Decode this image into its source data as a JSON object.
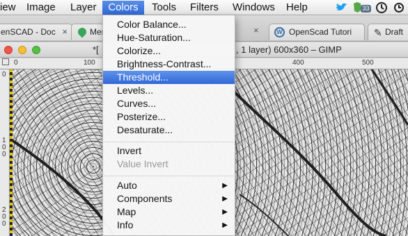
{
  "menubar": {
    "items": [
      "iew",
      "Image",
      "Layer",
      "Colors",
      "Tools",
      "Filters",
      "Windows",
      "Help"
    ],
    "active": "Colors",
    "badge": "33"
  },
  "tabs": [
    {
      "label": "enSCAD - Doc"
    },
    {
      "label": "Mer"
    },
    {
      "label": "OpenScad Tutori"
    },
    {
      "label": "Draft"
    }
  ],
  "window": {
    "title_left": "*[",
    "title_right": ", 1 layer) 600x360 – GIMP"
  },
  "ruler": {
    "h_ticks": [
      "0",
      "100",
      "400",
      "500"
    ],
    "v_ticks": [
      "0",
      "1\n0\n0",
      "2\n0\n0"
    ]
  },
  "colors_menu": {
    "group1": [
      "Color Balance...",
      "Hue-Saturation...",
      "Colorize...",
      "Brightness-Contrast...",
      "Threshold...",
      "Levels...",
      "Curves...",
      "Posterize...",
      "Desaturate..."
    ],
    "highlighted": "Threshold...",
    "group2": [
      "Invert",
      "Value Invert"
    ],
    "disabled": "Value Invert",
    "group3": [
      "Auto",
      "Components",
      "Map",
      "Info"
    ],
    "submenu_arrow": "▶"
  },
  "colors": {
    "accent": "#3068d6",
    "twitter": "#1da1f2",
    "evernote": "#56a846"
  }
}
